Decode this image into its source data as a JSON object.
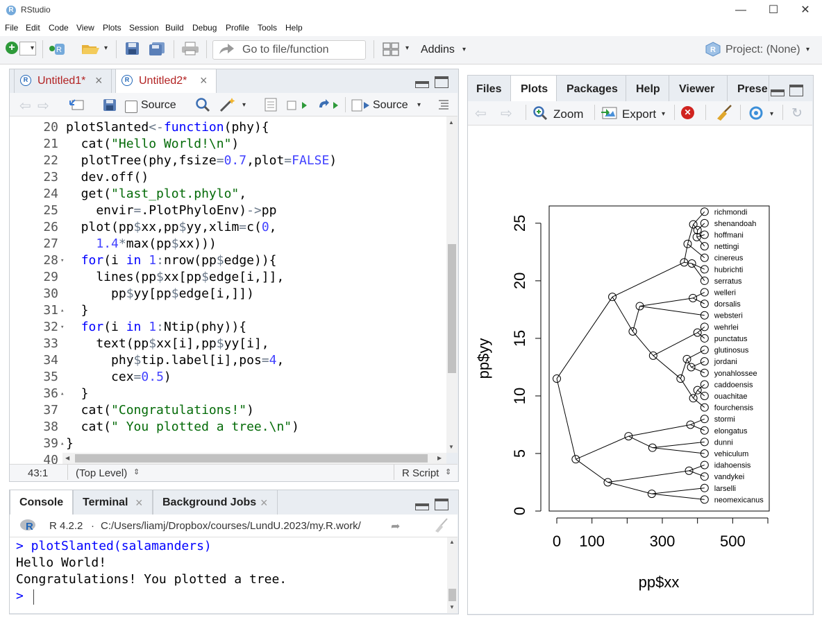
{
  "window": {
    "title": "RStudio",
    "logo_letter": "R",
    "minimize": "—",
    "maximize": "☐",
    "close": "✕"
  },
  "menu": [
    "File",
    "Edit",
    "Code",
    "View",
    "Plots",
    "Session",
    "Build",
    "Debug",
    "Profile",
    "Tools",
    "Help"
  ],
  "toolbar": {
    "goto_placeholder": "Go to file/function",
    "addins_label": "Addins",
    "project_label": "Project: (None)"
  },
  "editor": {
    "tabs": [
      {
        "label": "Untitled1*",
        "close": "×"
      },
      {
        "label": "Untitled2*",
        "close": "×"
      }
    ],
    "source_on_save_label": "Source",
    "source_button_label": "Source",
    "lines": [
      {
        "num": "20",
        "fold": "",
        "segments": [
          [
            "plotSlanted",
            "n"
          ],
          [
            "<-",
            "o"
          ],
          [
            "function",
            "k"
          ],
          [
            "(phy){",
            "p"
          ]
        ]
      },
      {
        "num": "21",
        "fold": "",
        "segments": [
          [
            "  cat(",
            "n"
          ],
          [
            "\"Hello World!\\n\"",
            "s"
          ],
          [
            ")",
            "p"
          ]
        ]
      },
      {
        "num": "22",
        "fold": "",
        "segments": [
          [
            "  plotTree(phy,fsize",
            "n"
          ],
          [
            "=",
            "o"
          ],
          [
            "0.7",
            "c"
          ],
          [
            ",plot",
            "n"
          ],
          [
            "=",
            "o"
          ],
          [
            "FALSE",
            "c"
          ],
          [
            ")",
            "p"
          ]
        ]
      },
      {
        "num": "23",
        "fold": "",
        "segments": [
          [
            "  dev.off()",
            "n"
          ]
        ]
      },
      {
        "num": "24",
        "fold": "",
        "segments": [
          [
            "  get(",
            "n"
          ],
          [
            "\"last_plot.phylo\"",
            "s"
          ],
          [
            ",",
            "n"
          ]
        ]
      },
      {
        "num": "25",
        "fold": "",
        "segments": [
          [
            "    envir",
            "n"
          ],
          [
            "=",
            "o"
          ],
          [
            ".PlotPhyloEnv)",
            "n"
          ],
          [
            "->",
            "o"
          ],
          [
            "pp",
            "n"
          ]
        ]
      },
      {
        "num": "26",
        "fold": "",
        "segments": [
          [
            "  plot(pp",
            "n"
          ],
          [
            "$",
            "o"
          ],
          [
            "xx,pp",
            "n"
          ],
          [
            "$",
            "o"
          ],
          [
            "yy,xlim",
            "n"
          ],
          [
            "=",
            "o"
          ],
          [
            "c(",
            "n"
          ],
          [
            "0",
            "c"
          ],
          [
            ",",
            "n"
          ]
        ]
      },
      {
        "num": "27",
        "fold": "",
        "segments": [
          [
            "    ",
            "n"
          ],
          [
            "1.4",
            "c"
          ],
          [
            "*",
            "o"
          ],
          [
            "max(pp",
            "n"
          ],
          [
            "$",
            "o"
          ],
          [
            "xx)))",
            "n"
          ]
        ]
      },
      {
        "num": "28",
        "fold": "▾",
        "segments": [
          [
            "  ",
            "n"
          ],
          [
            "for",
            "k"
          ],
          [
            "(i ",
            "n"
          ],
          [
            "in",
            "k"
          ],
          [
            " ",
            "n"
          ],
          [
            "1",
            "c"
          ],
          [
            ":",
            "o"
          ],
          [
            "nrow(pp",
            "n"
          ],
          [
            "$",
            "o"
          ],
          [
            "edge)){",
            "n"
          ]
        ]
      },
      {
        "num": "29",
        "fold": "",
        "segments": [
          [
            "    lines(pp",
            "n"
          ],
          [
            "$",
            "o"
          ],
          [
            "xx[pp",
            "n"
          ],
          [
            "$",
            "o"
          ],
          [
            "edge[i,]],",
            "n"
          ]
        ]
      },
      {
        "num": "30",
        "fold": "",
        "segments": [
          [
            "      pp",
            "n"
          ],
          [
            "$",
            "o"
          ],
          [
            "yy[pp",
            "n"
          ],
          [
            "$",
            "o"
          ],
          [
            "edge[i,]])",
            "n"
          ]
        ]
      },
      {
        "num": "31",
        "fold": "▴",
        "segments": [
          [
            "  }",
            "n"
          ]
        ]
      },
      {
        "num": "32",
        "fold": "▾",
        "segments": [
          [
            "  ",
            "n"
          ],
          [
            "for",
            "k"
          ],
          [
            "(i ",
            "n"
          ],
          [
            "in",
            "k"
          ],
          [
            " ",
            "n"
          ],
          [
            "1",
            "c"
          ],
          [
            ":",
            "o"
          ],
          [
            "Ntip(phy)){",
            "n"
          ]
        ]
      },
      {
        "num": "33",
        "fold": "",
        "segments": [
          [
            "    text(pp",
            "n"
          ],
          [
            "$",
            "o"
          ],
          [
            "xx[i],pp",
            "n"
          ],
          [
            "$",
            "o"
          ],
          [
            "yy[i],",
            "n"
          ]
        ]
      },
      {
        "num": "34",
        "fold": "",
        "segments": [
          [
            "      phy",
            "n"
          ],
          [
            "$",
            "o"
          ],
          [
            "tip.label[i],pos",
            "n"
          ],
          [
            "=",
            "o"
          ],
          [
            "4",
            "c"
          ],
          [
            ",",
            "n"
          ]
        ]
      },
      {
        "num": "35",
        "fold": "",
        "segments": [
          [
            "      cex",
            "n"
          ],
          [
            "=",
            "o"
          ],
          [
            "0.5",
            "c"
          ],
          [
            ")",
            "n"
          ]
        ]
      },
      {
        "num": "36",
        "fold": "▴",
        "segments": [
          [
            "  }",
            "n"
          ]
        ]
      },
      {
        "num": "37",
        "fold": "",
        "segments": [
          [
            "  cat(",
            "n"
          ],
          [
            "\"Congratulations!\"",
            "s"
          ],
          [
            ")",
            "n"
          ]
        ]
      },
      {
        "num": "38",
        "fold": "",
        "segments": [
          [
            "  cat(",
            "n"
          ],
          [
            "\" You plotted a tree.\\n\"",
            "s"
          ],
          [
            ")",
            "n"
          ]
        ]
      },
      {
        "num": "39",
        "fold": "▴",
        "segments": [
          [
            "}",
            "n"
          ]
        ]
      },
      {
        "num": "40",
        "fold": "",
        "segments": []
      }
    ],
    "status": {
      "position": "43:1",
      "scope": "(Top Level)",
      "filetype": "R Script"
    }
  },
  "console": {
    "tabs": [
      {
        "label": "Console",
        "close": ""
      },
      {
        "label": "Terminal",
        "close": "×"
      },
      {
        "label": "Background Jobs",
        "close": "×"
      }
    ],
    "r_version": "R 4.2.2",
    "path": "C:/Users/liamj/Dropbox/courses/LundU.2023/my.R.work/",
    "lines": [
      {
        "text": "> plotSlanted(salamanders)",
        "kind": "cmd"
      },
      {
        "text": "Hello World!",
        "kind": "out"
      },
      {
        "text": "Congratulations! You plotted a tree.",
        "kind": "out"
      },
      {
        "text": ">",
        "kind": "cmd"
      }
    ]
  },
  "files_pane": {
    "tabs": [
      "Files",
      "Plots",
      "Packages",
      "Help",
      "Viewer",
      "Prese"
    ],
    "zoom_label": "Zoom",
    "export_label": "Export"
  },
  "colors": {
    "keyword": "#0000ff",
    "string": "#036a07",
    "number": "#4141ff",
    "operator": "#687687",
    "prompt": "#0000ff",
    "tab_active_text": "#b22222"
  },
  "chart_data": {
    "type": "scatter",
    "xlabel": "pp$xx",
    "ylabel": "pp$yy",
    "xticks": [
      "0",
      "100",
      "300",
      "500"
    ],
    "yticks": [
      "0",
      "5",
      "10",
      "15",
      "20",
      "25"
    ],
    "xlim": [
      0,
      598
    ],
    "ylim": [
      0,
      26.5
    ],
    "tips": [
      {
        "label": "richmondi",
        "x": 420,
        "y": 26
      },
      {
        "label": "shenandoah",
        "x": 420,
        "y": 25
      },
      {
        "label": "hoffmani",
        "x": 420,
        "y": 24
      },
      {
        "label": "nettingi",
        "x": 420,
        "y": 23
      },
      {
        "label": "cinereus",
        "x": 420,
        "y": 22
      },
      {
        "label": "hubrichti",
        "x": 420,
        "y": 21
      },
      {
        "label": "serratus",
        "x": 420,
        "y": 20
      },
      {
        "label": "welleri",
        "x": 420,
        "y": 19
      },
      {
        "label": "dorsalis",
        "x": 420,
        "y": 18
      },
      {
        "label": "websteri",
        "x": 420,
        "y": 17
      },
      {
        "label": "wehrlei",
        "x": 420,
        "y": 16
      },
      {
        "label": "punctatus",
        "x": 420,
        "y": 15
      },
      {
        "label": "glutinosus",
        "x": 420,
        "y": 14
      },
      {
        "label": "jordani",
        "x": 420,
        "y": 13
      },
      {
        "label": "yonahlossee",
        "x": 420,
        "y": 12
      },
      {
        "label": "caddoensis",
        "x": 420,
        "y": 11
      },
      {
        "label": "ouachitae",
        "x": 420,
        "y": 10
      },
      {
        "label": "fourchensis",
        "x": 420,
        "y": 9
      },
      {
        "label": "stormi",
        "x": 420,
        "y": 8
      },
      {
        "label": "elongatus",
        "x": 420,
        "y": 7
      },
      {
        "label": "dunni",
        "x": 420,
        "y": 6
      },
      {
        "label": "vehiculum",
        "x": 420,
        "y": 5
      },
      {
        "label": "idahoensis",
        "x": 420,
        "y": 4
      },
      {
        "label": "vandykei",
        "x": 420,
        "y": 3
      },
      {
        "label": "larselli",
        "x": 420,
        "y": 2
      },
      {
        "label": "neomexicanus",
        "x": 420,
        "y": 1
      }
    ],
    "nodes": [
      {
        "id": "root",
        "x": 0,
        "y": 11.5
      },
      {
        "id": "n1",
        "x": 158,
        "y": 18.6
      },
      {
        "id": "n2",
        "x": 362,
        "y": 21.6
      },
      {
        "id": "n3",
        "x": 384,
        "y": 21.5
      },
      {
        "id": "n4",
        "x": 372,
        "y": 23.2
      },
      {
        "id": "n5",
        "x": 388,
        "y": 24.9
      },
      {
        "id": "n6",
        "x": 400,
        "y": 24.4
      },
      {
        "id": "n7",
        "x": 398,
        "y": 23.8
      },
      {
        "id": "n8",
        "x": 216,
        "y": 15.6
      },
      {
        "id": "n9",
        "x": 236,
        "y": 17.8
      },
      {
        "id": "n10",
        "x": 387,
        "y": 18.5
      },
      {
        "id": "n11",
        "x": 274,
        "y": 13.5
      },
      {
        "id": "n12",
        "x": 400,
        "y": 15.5
      },
      {
        "id": "n13",
        "x": 352,
        "y": 11.5
      },
      {
        "id": "n14",
        "x": 370,
        "y": 13.2
      },
      {
        "id": "n15",
        "x": 382,
        "y": 12.5
      },
      {
        "id": "n16",
        "x": 388,
        "y": 9.8
      },
      {
        "id": "n17",
        "x": 400,
        "y": 10.5
      },
      {
        "id": "n18",
        "x": 54,
        "y": 4.5
      },
      {
        "id": "n19",
        "x": 204,
        "y": 6.5
      },
      {
        "id": "n20",
        "x": 380,
        "y": 7.5
      },
      {
        "id": "n21",
        "x": 272,
        "y": 5.5
      },
      {
        "id": "n22",
        "x": 145,
        "y": 2.5
      },
      {
        "id": "n23",
        "x": 376,
        "y": 3.5
      },
      {
        "id": "n24",
        "x": 270,
        "y": 1.5
      }
    ],
    "edges": [
      [
        "root",
        "n1"
      ],
      [
        "root",
        "n18"
      ],
      [
        "n1",
        "n2"
      ],
      [
        "n1",
        "n8"
      ],
      [
        "n2",
        "n3"
      ],
      [
        "n2",
        "n4"
      ],
      [
        "n3",
        "hubrichti"
      ],
      [
        "n3",
        "serratus"
      ],
      [
        "n4",
        "n5"
      ],
      [
        "n4",
        "cinereus"
      ],
      [
        "n5",
        "richmondi"
      ],
      [
        "n5",
        "n6"
      ],
      [
        "n6",
        "shenandoah"
      ],
      [
        "n6",
        "n7"
      ],
      [
        "n7",
        "hoffmani"
      ],
      [
        "n7",
        "nettingi"
      ],
      [
        "n8",
        "n9"
      ],
      [
        "n8",
        "n11"
      ],
      [
        "n9",
        "n10"
      ],
      [
        "n9",
        "websteri"
      ],
      [
        "n10",
        "welleri"
      ],
      [
        "n10",
        "dorsalis"
      ],
      [
        "n11",
        "n12"
      ],
      [
        "n11",
        "n13"
      ],
      [
        "n12",
        "wehrlei"
      ],
      [
        "n12",
        "punctatus"
      ],
      [
        "n13",
        "n14"
      ],
      [
        "n13",
        "n16"
      ],
      [
        "n14",
        "glutinosus"
      ],
      [
        "n14",
        "n15"
      ],
      [
        "n15",
        "jordani"
      ],
      [
        "n15",
        "yonahlossee"
      ],
      [
        "n16",
        "n17"
      ],
      [
        "n16",
        "fourchensis"
      ],
      [
        "n17",
        "caddoensis"
      ],
      [
        "n17",
        "ouachitae"
      ],
      [
        "n18",
        "n19"
      ],
      [
        "n18",
        "n22"
      ],
      [
        "n19",
        "n20"
      ],
      [
        "n19",
        "n21"
      ],
      [
        "n20",
        "stormi"
      ],
      [
        "n20",
        "elongatus"
      ],
      [
        "n21",
        "dunni"
      ],
      [
        "n21",
        "vehiculum"
      ],
      [
        "n22",
        "n23"
      ],
      [
        "n22",
        "n24"
      ],
      [
        "n23",
        "idahoensis"
      ],
      [
        "n23",
        "vandykei"
      ],
      [
        "n24",
        "larselli"
      ],
      [
        "n24",
        "neomexicanus"
      ]
    ]
  }
}
